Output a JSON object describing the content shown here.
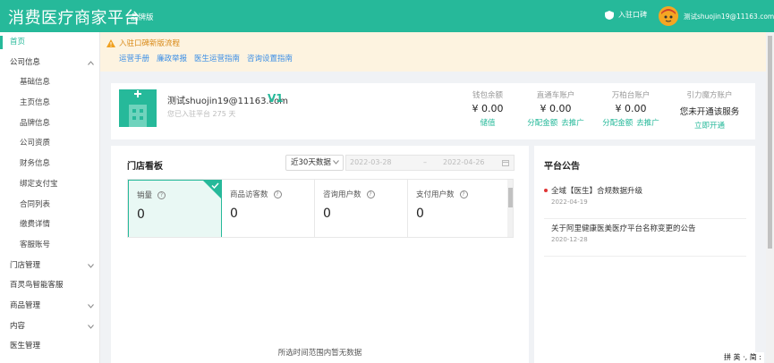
{
  "topbar": {
    "brand": "消费医疗商家平台",
    "edition": "品牌版",
    "settle_label": "入驻口碑",
    "user_email": "测试shuojin19@11163.com"
  },
  "sidebar": {
    "items": [
      {
        "label": "首页"
      },
      {
        "label": "公司信息"
      },
      {
        "label": "基础信息"
      },
      {
        "label": "主页信息"
      },
      {
        "label": "品牌信息"
      },
      {
        "label": "公司资质"
      },
      {
        "label": "财务信息"
      },
      {
        "label": "绑定支付宝"
      },
      {
        "label": "合同列表"
      },
      {
        "label": "缴费详情"
      },
      {
        "label": "客服账号"
      },
      {
        "label": "门店管理"
      },
      {
        "label": "百灵鸟智能客服"
      },
      {
        "label": "商品管理"
      },
      {
        "label": "内容"
      },
      {
        "label": "医生管理"
      }
    ]
  },
  "notice": {
    "title": "入驻口碑新版流程",
    "links": [
      "运营手册",
      "廉政举报",
      "医生运营指南",
      "咨询设置指南"
    ]
  },
  "shop": {
    "name": "测试shuojin19@11163.com",
    "level": "V1",
    "joined": "您已入驻平台 275 天"
  },
  "accounts": [
    {
      "title": "钱包余额",
      "value": "¥ 0.00",
      "links": [
        "储值"
      ]
    },
    {
      "title": "直通车账户",
      "value": "¥ 0.00",
      "links": [
        "分配金额",
        "去推广"
      ]
    },
    {
      "title": "万柏台账户",
      "value": "¥ 0.00",
      "links": [
        "分配金额",
        "去推广"
      ]
    },
    {
      "title": "引力魔方账户",
      "value": "您未开通该服务",
      "links": [
        "立即开通"
      ]
    }
  ],
  "board": {
    "title": "门店看板",
    "range": "近30天数据",
    "start_date": "2022-03-28",
    "date_sep": "–",
    "end_date": "2022-04-26",
    "stats": [
      {
        "label": "销量",
        "value": "0"
      },
      {
        "label": "商品访客数",
        "value": "0"
      },
      {
        "label": "咨询用户数",
        "value": "0"
      },
      {
        "label": "支付用户数",
        "value": "0"
      }
    ],
    "empty_text": "所选时间范围内暂无数据"
  },
  "announcements": {
    "title": "平台公告",
    "items": [
      {
        "text": "全域【医生】合规数据升级",
        "date": "2022-04-19"
      },
      {
        "text": "关于阿里健康医美医疗平台名称变更的公告",
        "date": "2020-12-28"
      }
    ]
  },
  "ime": {
    "label": "拼 英 ·, 简 :"
  },
  "colors": {
    "brand": "#26b99a",
    "notice_bg": "#fdf3e0",
    "link": "#3a8ee6",
    "alert_dot": "#e03535"
  }
}
